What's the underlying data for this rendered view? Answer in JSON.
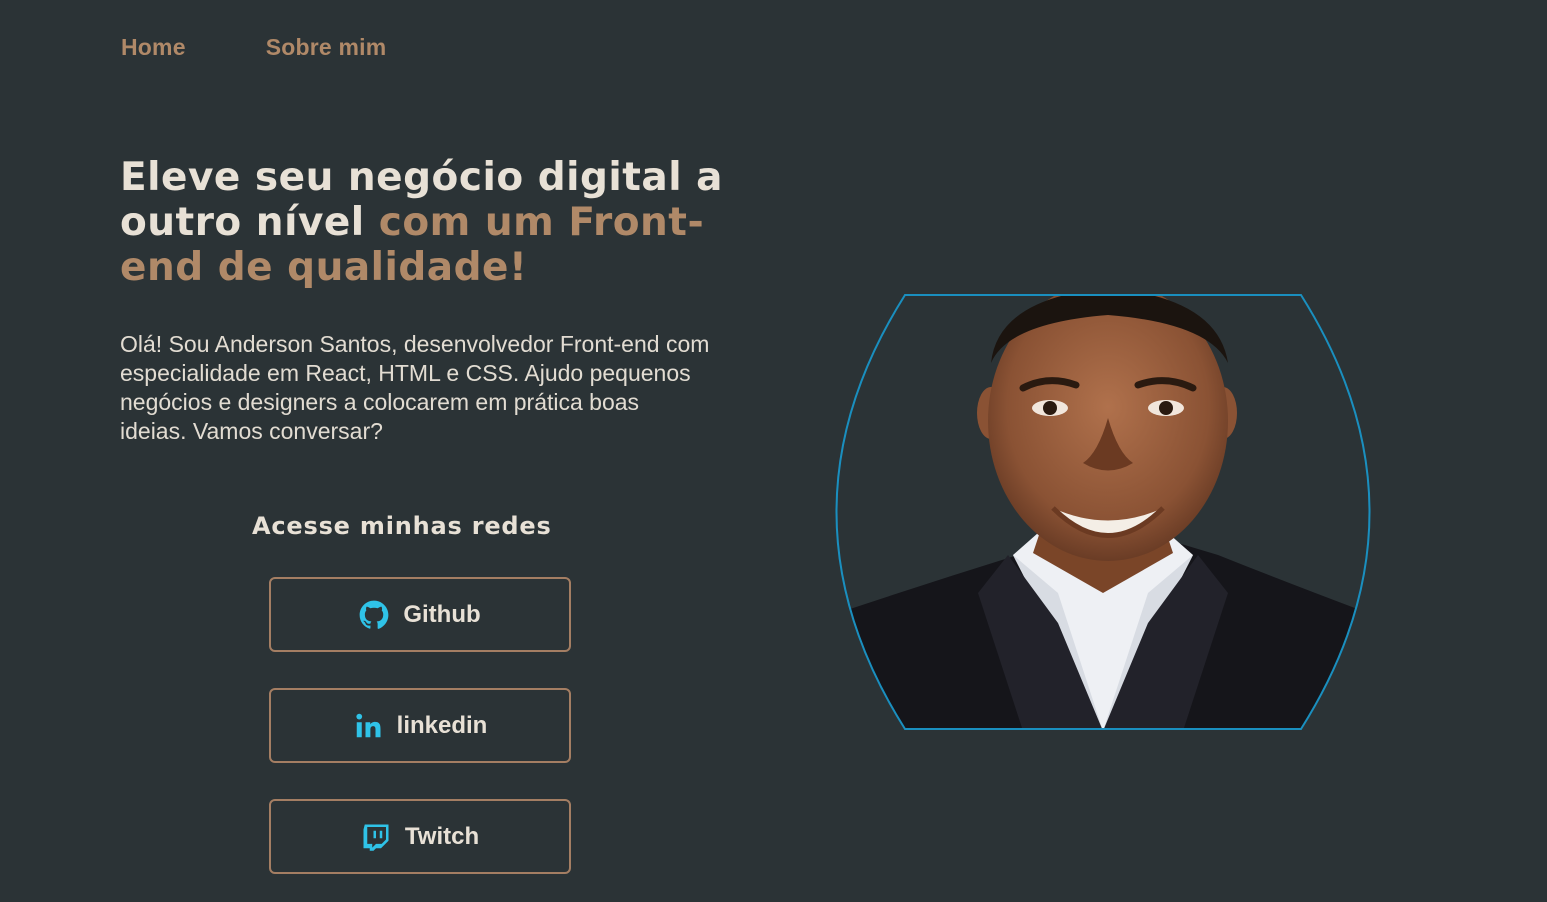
{
  "nav": {
    "home": "Home",
    "about": "Sobre mim"
  },
  "hero": {
    "headline_plain": "Eleve seu negócio digital a outro nível",
    "headline_accent": "com um Front-end de qualidade!",
    "intro": "Olá! Sou Anderson Santos, desenvolvedor Front-end com especialidade em React, HTML e CSS. Ajudo pequenos negócios e designers a colocarem em prática boas ideias. Vamos conversar?"
  },
  "social": {
    "title": "Acesse minhas redes",
    "buttons": [
      {
        "label": "Github",
        "icon": "github-icon"
      },
      {
        "label": "linkedin",
        "icon": "linkedin-icon"
      },
      {
        "label": "Twitch",
        "icon": "twitch-icon"
      }
    ]
  },
  "colors": {
    "background": "#2b3336",
    "accent": "#b08968",
    "text": "#e8e1d6",
    "icon": "#2fc3e8",
    "photo_border": "#1a8fbf"
  }
}
